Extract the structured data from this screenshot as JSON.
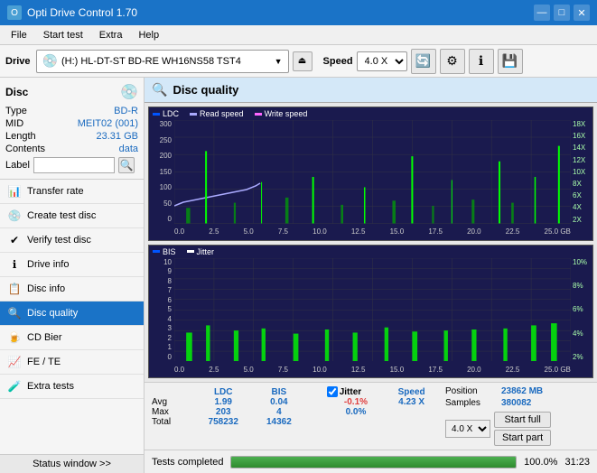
{
  "titleBar": {
    "title": "Opti Drive Control 1.70",
    "minBtn": "—",
    "maxBtn": "□",
    "closeBtn": "✕"
  },
  "menuBar": {
    "items": [
      "File",
      "Start test",
      "Extra",
      "Help"
    ]
  },
  "toolbar": {
    "driveLabel": "Drive",
    "driveText": "(H:)  HL-DT-ST BD-RE  WH16NS58 TST4",
    "ejectIcon": "⏏",
    "speedLabel": "Speed",
    "speedValue": "4.0 X"
  },
  "disc": {
    "title": "Disc",
    "type": {
      "key": "Type",
      "val": "BD-R"
    },
    "mid": {
      "key": "MID",
      "val": "MEIT02 (001)"
    },
    "length": {
      "key": "Length",
      "val": "23.31 GB"
    },
    "contents": {
      "key": "Contents",
      "val": "data"
    },
    "label": {
      "key": "Label",
      "val": ""
    }
  },
  "nav": {
    "items": [
      {
        "id": "transfer-rate",
        "label": "Transfer rate",
        "icon": "📊"
      },
      {
        "id": "create-test-disc",
        "label": "Create test disc",
        "icon": "💿"
      },
      {
        "id": "verify-test-disc",
        "label": "Verify test disc",
        "icon": "✔"
      },
      {
        "id": "drive-info",
        "label": "Drive info",
        "icon": "ℹ"
      },
      {
        "id": "disc-info",
        "label": "Disc info",
        "icon": "📋"
      },
      {
        "id": "disc-quality",
        "label": "Disc quality",
        "icon": "🔍",
        "active": true
      },
      {
        "id": "cd-bier",
        "label": "CD Bier",
        "icon": "🍺"
      },
      {
        "id": "fe-te",
        "label": "FE / TE",
        "icon": "📈"
      },
      {
        "id": "extra-tests",
        "label": "Extra tests",
        "icon": "🧪"
      }
    ]
  },
  "statusWindow": "Status window >>",
  "contentTitle": "Disc quality",
  "charts": {
    "top": {
      "legend": [
        {
          "label": "LDC",
          "color": "#0000ff"
        },
        {
          "label": "Read speed",
          "color": "#aaaaff"
        },
        {
          "label": "Write speed",
          "color": "#ff66ff"
        }
      ],
      "yLabels": [
        "300",
        "250",
        "200",
        "150",
        "100",
        "50",
        "0"
      ],
      "yLabelsRight": [
        "18X",
        "16X",
        "14X",
        "12X",
        "10X",
        "8X",
        "6X",
        "4X",
        "2X"
      ],
      "xLabels": [
        "0.0",
        "2.5",
        "5.0",
        "7.5",
        "10.0",
        "12.5",
        "15.0",
        "17.5",
        "20.0",
        "22.5",
        "25.0 GB"
      ]
    },
    "bottom": {
      "legend": [
        {
          "label": "BIS",
          "color": "#0000ff"
        },
        {
          "label": "Jitter",
          "color": "#ffffff"
        }
      ],
      "yLabels": [
        "10",
        "9",
        "8",
        "7",
        "6",
        "5",
        "4",
        "3",
        "2",
        "1",
        "0"
      ],
      "yLabelsRight": [
        "10%",
        "8%",
        "6%",
        "4%",
        "2%"
      ],
      "xLabels": [
        "0.0",
        "2.5",
        "5.0",
        "7.5",
        "10.0",
        "12.5",
        "15.0",
        "17.5",
        "20.0",
        "22.5",
        "25.0 GB"
      ]
    }
  },
  "stats": {
    "headers": [
      "",
      "LDC",
      "BIS",
      "",
      "Jitter",
      "Speed"
    ],
    "avg": {
      "label": "Avg",
      "ldc": "1.99",
      "bis": "0.04",
      "jitter": "-0.1%",
      "speed": "4.23 X"
    },
    "max": {
      "label": "Max",
      "ldc": "203",
      "bis": "4",
      "jitter": "0.0%"
    },
    "total": {
      "label": "Total",
      "ldc": "758232",
      "bis": "14362"
    },
    "position": {
      "key": "Position",
      "val": "23862 MB"
    },
    "samples": {
      "key": "Samples",
      "val": "380082"
    },
    "speedDropdown": "4.0 X",
    "startFull": "Start full",
    "startPart": "Start part"
  },
  "progressBar": {
    "percent": "100.0%",
    "time": "31:23"
  },
  "statusText": "Tests completed"
}
